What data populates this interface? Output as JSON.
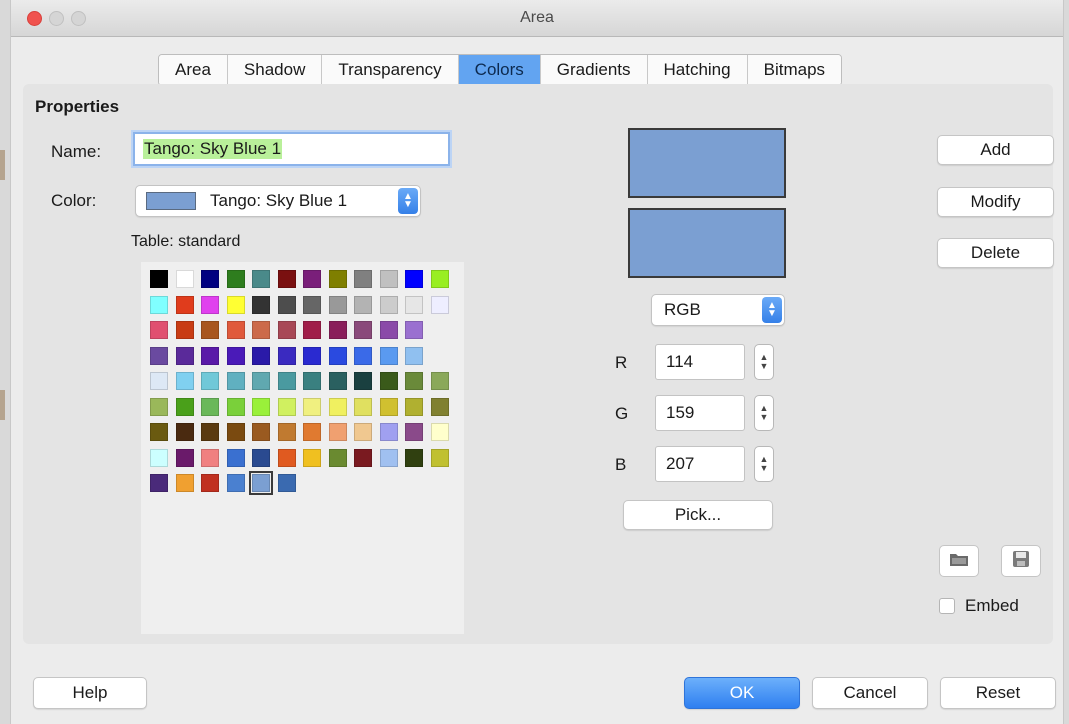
{
  "window": {
    "title": "Area"
  },
  "tabs": [
    {
      "label": "Area"
    },
    {
      "label": "Shadow"
    },
    {
      "label": "Transparency"
    },
    {
      "label": "Colors"
    },
    {
      "label": "Gradients"
    },
    {
      "label": "Hatching"
    },
    {
      "label": "Bitmaps"
    }
  ],
  "active_tab": "Colors",
  "properties": {
    "heading": "Properties",
    "name_label": "Name:",
    "name_value": "Tango: Sky Blue 1",
    "color_label": "Color:",
    "color_value": "Tango: Sky Blue 1",
    "color_swatch": "#7b9fd2",
    "table_label": "Table: standard"
  },
  "palette": {
    "rows": [
      [
        "#000000",
        "#ffffff",
        "#000080",
        "#2e7d1e",
        "#4a8a8a",
        "#7a1010",
        "#7a1f7a",
        "#7f7f00",
        "#808080",
        "#c0c0c0",
        "#0000ff",
        "#99ee22"
      ],
      [
        "#80ffff",
        "#e03c1c",
        "#e040ee",
        "#ffff33",
        "#333333",
        "#4d4d4d",
        "#666666",
        "#999999",
        "#b3b3b3",
        "#cccccc",
        "#e6e6e6",
        "#eeeeff"
      ],
      [
        "#e05070",
        "#c83c14",
        "#a8561e",
        "#e05a3c",
        "#cc6a4a",
        "#a84856",
        "#a01e4a",
        "#8a1e5a",
        "#8a4a7a",
        "#8a4aa8",
        "#9a70d0"
      ],
      [
        "#6a4aa0",
        "#5a2a9a",
        "#5a1aa8",
        "#4a1ab8",
        "#2a1aa8",
        "#3a2ac0",
        "#2a2ad0",
        "#2a4ae0",
        "#3a6ae8",
        "#5a9af0",
        "#90c0f0"
      ],
      [
        "#dde8f5",
        "#80d0f0",
        "#70c8d8",
        "#60b0c0",
        "#60a8b0",
        "#4a9aa0",
        "#3a8080",
        "#2a6060",
        "#1a4040",
        "#3a5a1a",
        "#6a8a3a",
        "#8aa85a"
      ],
      [
        "#9ab85a",
        "#4aa01a",
        "#6ab85a",
        "#7ad03a",
        "#9af03a",
        "#d0f060",
        "#f0f080",
        "#f0f060",
        "#e0e060",
        "#d0c030",
        "#b0b030",
        "#808030"
      ],
      [
        "#6a5a10",
        "#4a2a10",
        "#5a3a10",
        "#7a4a10",
        "#9a5a20",
        "#c07a30",
        "#e07a30",
        "#f0a070",
        "#f0c890",
        "#a0a0f0",
        "#8a4a8a",
        "#ffffcc"
      ],
      [
        "#ccffff",
        "#6a1a6a",
        "#f08080",
        "#3a70d0",
        "#2a4a90",
        "#e05a20",
        "#f0c020",
        "#6a8a30",
        "#7a1a20",
        "#a0c0f0",
        "#304010",
        "#c0c030"
      ],
      [
        "#4a2a7a",
        "#f0a030",
        "#c03020",
        "#4a80d0",
        "#7b9fd2",
        "#3a6ab0"
      ]
    ],
    "selected_row": 8,
    "selected_index": 4
  },
  "preview": {
    "old_color": "#7b9fd2",
    "new_color": "#7b9fd2"
  },
  "color_model": {
    "value": "RGB"
  },
  "rgb": {
    "r_label": "R",
    "r_value": "114",
    "g_label": "G",
    "g_value": "159",
    "b_label": "B",
    "b_value": "207"
  },
  "buttons": {
    "pick": "Pick...",
    "add": "Add",
    "modify": "Modify",
    "delete": "Delete",
    "help": "Help",
    "ok": "OK",
    "cancel": "Cancel",
    "reset": "Reset"
  },
  "embed": {
    "label": "Embed",
    "checked": false
  },
  "icons": {
    "load": "folder-icon",
    "save": "save-icon"
  }
}
